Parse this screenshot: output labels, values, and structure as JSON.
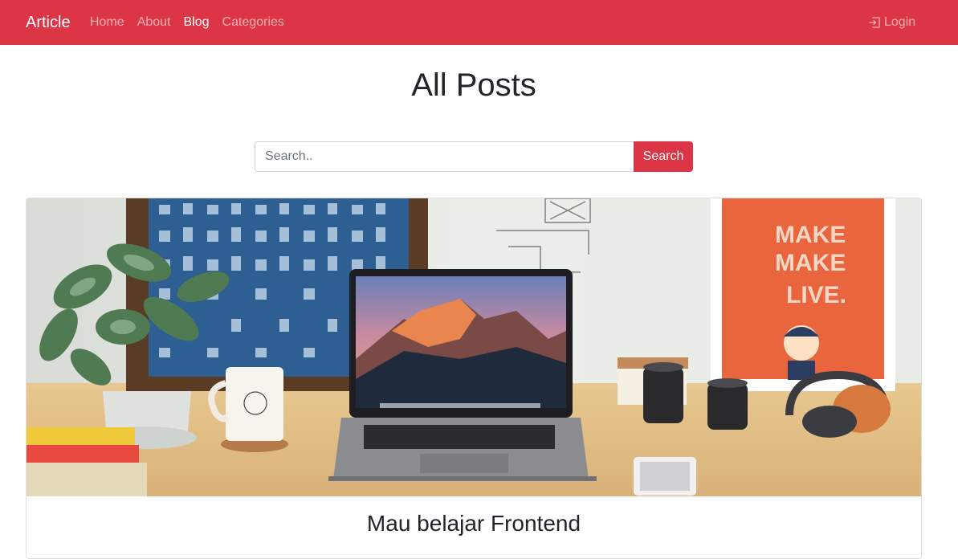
{
  "navbar": {
    "brand": "Article",
    "links": [
      {
        "label": "Home",
        "active": false
      },
      {
        "label": "About",
        "active": false
      },
      {
        "label": "Blog",
        "active": true
      },
      {
        "label": "Categories",
        "active": false
      }
    ],
    "login_label": "Login",
    "login_icon": "sign-in-icon",
    "color": "#dc3545"
  },
  "page": {
    "title": "All Posts"
  },
  "search": {
    "placeholder": "Search..",
    "value": "",
    "button_label": "Search"
  },
  "posts": [
    {
      "title": "Mau belajar Frontend",
      "image": "desk-laptop-photo"
    }
  ]
}
